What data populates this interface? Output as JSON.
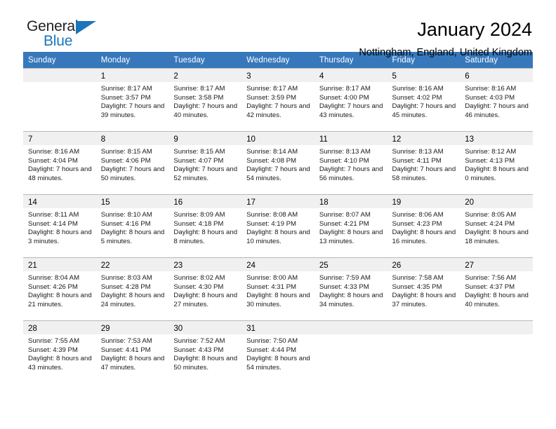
{
  "brand": {
    "name_part1": "General",
    "name_part2": "Blue",
    "triangle_color": "#1b75bb"
  },
  "header": {
    "title": "January 2024",
    "location": "Nottingham, England, United Kingdom"
  },
  "theme": {
    "header_row_bg": "#3778bc",
    "day_number_bg": "#f0f0f0",
    "grid_line": "#b8b8b8"
  },
  "calendar": {
    "weekday_headers": [
      "Sunday",
      "Monday",
      "Tuesday",
      "Wednesday",
      "Thursday",
      "Friday",
      "Saturday"
    ],
    "weeks": [
      [
        {
          "day": "",
          "sunrise": "",
          "sunset": "",
          "daylight": ""
        },
        {
          "day": "1",
          "sunrise": "Sunrise: 8:17 AM",
          "sunset": "Sunset: 3:57 PM",
          "daylight": "Daylight: 7 hours and 39 minutes."
        },
        {
          "day": "2",
          "sunrise": "Sunrise: 8:17 AM",
          "sunset": "Sunset: 3:58 PM",
          "daylight": "Daylight: 7 hours and 40 minutes."
        },
        {
          "day": "3",
          "sunrise": "Sunrise: 8:17 AM",
          "sunset": "Sunset: 3:59 PM",
          "daylight": "Daylight: 7 hours and 42 minutes."
        },
        {
          "day": "4",
          "sunrise": "Sunrise: 8:17 AM",
          "sunset": "Sunset: 4:00 PM",
          "daylight": "Daylight: 7 hours and 43 minutes."
        },
        {
          "day": "5",
          "sunrise": "Sunrise: 8:16 AM",
          "sunset": "Sunset: 4:02 PM",
          "daylight": "Daylight: 7 hours and 45 minutes."
        },
        {
          "day": "6",
          "sunrise": "Sunrise: 8:16 AM",
          "sunset": "Sunset: 4:03 PM",
          "daylight": "Daylight: 7 hours and 46 minutes."
        }
      ],
      [
        {
          "day": "7",
          "sunrise": "Sunrise: 8:16 AM",
          "sunset": "Sunset: 4:04 PM",
          "daylight": "Daylight: 7 hours and 48 minutes."
        },
        {
          "day": "8",
          "sunrise": "Sunrise: 8:15 AM",
          "sunset": "Sunset: 4:06 PM",
          "daylight": "Daylight: 7 hours and 50 minutes."
        },
        {
          "day": "9",
          "sunrise": "Sunrise: 8:15 AM",
          "sunset": "Sunset: 4:07 PM",
          "daylight": "Daylight: 7 hours and 52 minutes."
        },
        {
          "day": "10",
          "sunrise": "Sunrise: 8:14 AM",
          "sunset": "Sunset: 4:08 PM",
          "daylight": "Daylight: 7 hours and 54 minutes."
        },
        {
          "day": "11",
          "sunrise": "Sunrise: 8:13 AM",
          "sunset": "Sunset: 4:10 PM",
          "daylight": "Daylight: 7 hours and 56 minutes."
        },
        {
          "day": "12",
          "sunrise": "Sunrise: 8:13 AM",
          "sunset": "Sunset: 4:11 PM",
          "daylight": "Daylight: 7 hours and 58 minutes."
        },
        {
          "day": "13",
          "sunrise": "Sunrise: 8:12 AM",
          "sunset": "Sunset: 4:13 PM",
          "daylight": "Daylight: 8 hours and 0 minutes."
        }
      ],
      [
        {
          "day": "14",
          "sunrise": "Sunrise: 8:11 AM",
          "sunset": "Sunset: 4:14 PM",
          "daylight": "Daylight: 8 hours and 3 minutes."
        },
        {
          "day": "15",
          "sunrise": "Sunrise: 8:10 AM",
          "sunset": "Sunset: 4:16 PM",
          "daylight": "Daylight: 8 hours and 5 minutes."
        },
        {
          "day": "16",
          "sunrise": "Sunrise: 8:09 AM",
          "sunset": "Sunset: 4:18 PM",
          "daylight": "Daylight: 8 hours and 8 minutes."
        },
        {
          "day": "17",
          "sunrise": "Sunrise: 8:08 AM",
          "sunset": "Sunset: 4:19 PM",
          "daylight": "Daylight: 8 hours and 10 minutes."
        },
        {
          "day": "18",
          "sunrise": "Sunrise: 8:07 AM",
          "sunset": "Sunset: 4:21 PM",
          "daylight": "Daylight: 8 hours and 13 minutes."
        },
        {
          "day": "19",
          "sunrise": "Sunrise: 8:06 AM",
          "sunset": "Sunset: 4:23 PM",
          "daylight": "Daylight: 8 hours and 16 minutes."
        },
        {
          "day": "20",
          "sunrise": "Sunrise: 8:05 AM",
          "sunset": "Sunset: 4:24 PM",
          "daylight": "Daylight: 8 hours and 18 minutes."
        }
      ],
      [
        {
          "day": "21",
          "sunrise": "Sunrise: 8:04 AM",
          "sunset": "Sunset: 4:26 PM",
          "daylight": "Daylight: 8 hours and 21 minutes."
        },
        {
          "day": "22",
          "sunrise": "Sunrise: 8:03 AM",
          "sunset": "Sunset: 4:28 PM",
          "daylight": "Daylight: 8 hours and 24 minutes."
        },
        {
          "day": "23",
          "sunrise": "Sunrise: 8:02 AM",
          "sunset": "Sunset: 4:30 PM",
          "daylight": "Daylight: 8 hours and 27 minutes."
        },
        {
          "day": "24",
          "sunrise": "Sunrise: 8:00 AM",
          "sunset": "Sunset: 4:31 PM",
          "daylight": "Daylight: 8 hours and 30 minutes."
        },
        {
          "day": "25",
          "sunrise": "Sunrise: 7:59 AM",
          "sunset": "Sunset: 4:33 PM",
          "daylight": "Daylight: 8 hours and 34 minutes."
        },
        {
          "day": "26",
          "sunrise": "Sunrise: 7:58 AM",
          "sunset": "Sunset: 4:35 PM",
          "daylight": "Daylight: 8 hours and 37 minutes."
        },
        {
          "day": "27",
          "sunrise": "Sunrise: 7:56 AM",
          "sunset": "Sunset: 4:37 PM",
          "daylight": "Daylight: 8 hours and 40 minutes."
        }
      ],
      [
        {
          "day": "28",
          "sunrise": "Sunrise: 7:55 AM",
          "sunset": "Sunset: 4:39 PM",
          "daylight": "Daylight: 8 hours and 43 minutes."
        },
        {
          "day": "29",
          "sunrise": "Sunrise: 7:53 AM",
          "sunset": "Sunset: 4:41 PM",
          "daylight": "Daylight: 8 hours and 47 minutes."
        },
        {
          "day": "30",
          "sunrise": "Sunrise: 7:52 AM",
          "sunset": "Sunset: 4:43 PM",
          "daylight": "Daylight: 8 hours and 50 minutes."
        },
        {
          "day": "31",
          "sunrise": "Sunrise: 7:50 AM",
          "sunset": "Sunset: 4:44 PM",
          "daylight": "Daylight: 8 hours and 54 minutes."
        },
        {
          "day": "",
          "sunrise": "",
          "sunset": "",
          "daylight": ""
        },
        {
          "day": "",
          "sunrise": "",
          "sunset": "",
          "daylight": ""
        },
        {
          "day": "",
          "sunrise": "",
          "sunset": "",
          "daylight": ""
        }
      ]
    ]
  }
}
